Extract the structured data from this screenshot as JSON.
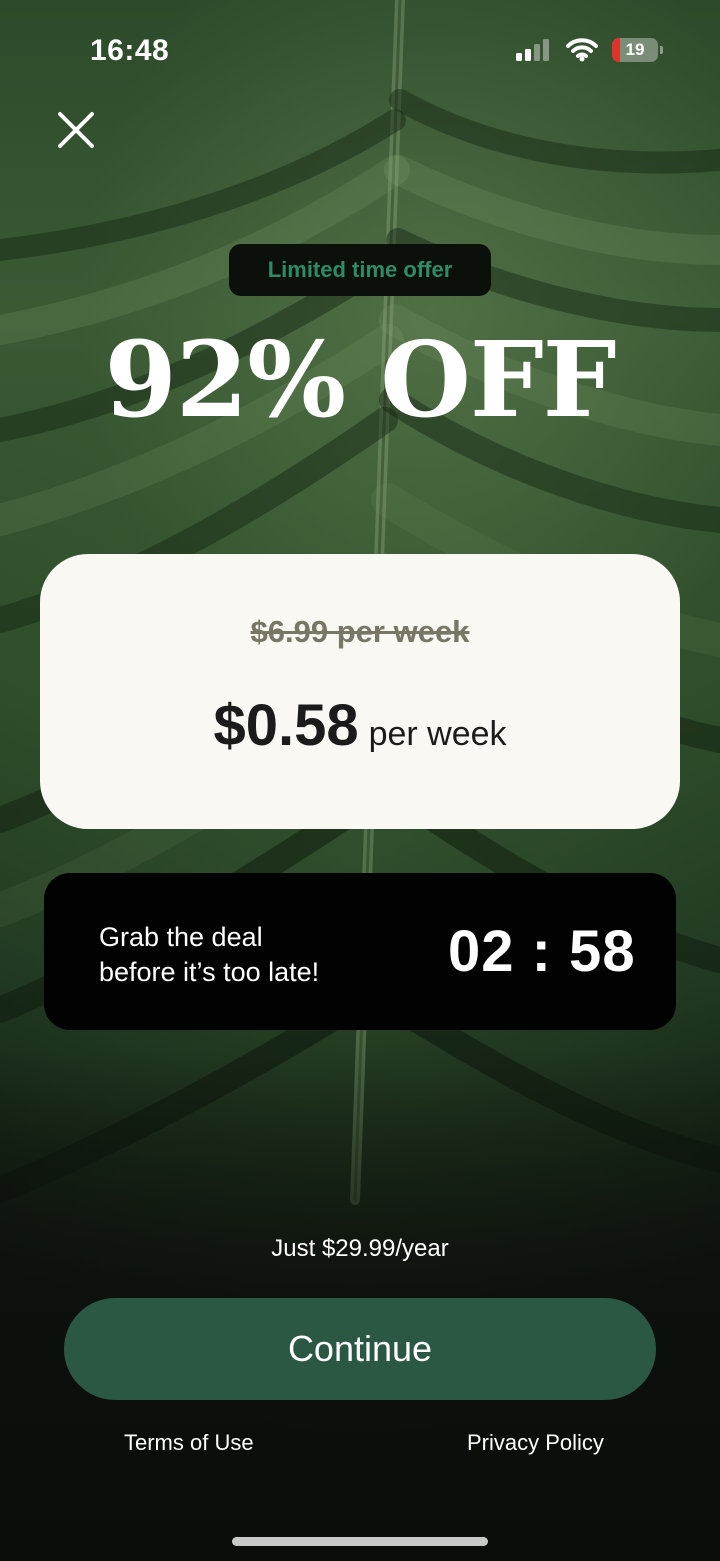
{
  "status_bar": {
    "time": "16:48",
    "battery_level": "19",
    "battery_color": "#e0342a"
  },
  "icons": {
    "close": "close-icon",
    "signal": "cellular-signal-icon",
    "wifi": "wifi-icon",
    "battery": "battery-icon"
  },
  "offer": {
    "badge": "Limited time offer",
    "headline": "92% OFF"
  },
  "pricing": {
    "original": "$6.99 per week",
    "amount": "$0.58",
    "unit": "per week"
  },
  "countdown": {
    "line1": "Grab the deal",
    "line2": "before it’s too late!",
    "time": "02 : 58"
  },
  "footer": {
    "yearly_note": "Just $29.99/year",
    "continue_label": "Continue",
    "terms_label": "Terms of Use",
    "privacy_label": "Privacy Policy"
  },
  "colors": {
    "accent": "#2b5842",
    "badge_text": "#2f8a66",
    "card_bg": "#f9f8f3"
  }
}
